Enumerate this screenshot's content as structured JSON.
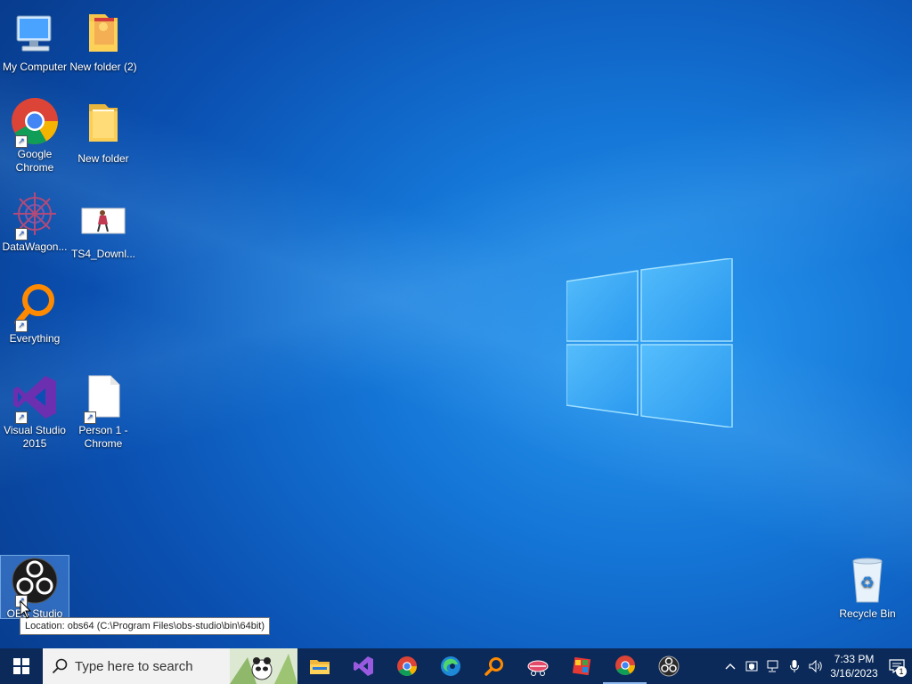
{
  "desktop": {
    "icons": {
      "my_computer": "My Computer",
      "new_folder_2": "New folder (2)",
      "google_chrome": "Google Chrome",
      "new_folder": "New folder",
      "datawagon": "DataWagon...",
      "ts4_download": "TS4_Downl...",
      "everything": "Everything",
      "visual_studio": "Visual Studio 2015",
      "person1_chrome": "Person 1 - Chrome",
      "obs_studio": "OBS Studio",
      "recycle_bin": "Recycle Bin"
    },
    "tooltip": "Location: obs64 (C:\\Program Files\\obs-studio\\bin\\64bit)"
  },
  "taskbar": {
    "search_placeholder": "Type here to search",
    "time": "7:33 PM",
    "date": "3/16/2023",
    "notification_count": "1"
  },
  "colors": {
    "taskbar_bg": "#0b2a59",
    "desktop_accent": "#1475d6"
  }
}
